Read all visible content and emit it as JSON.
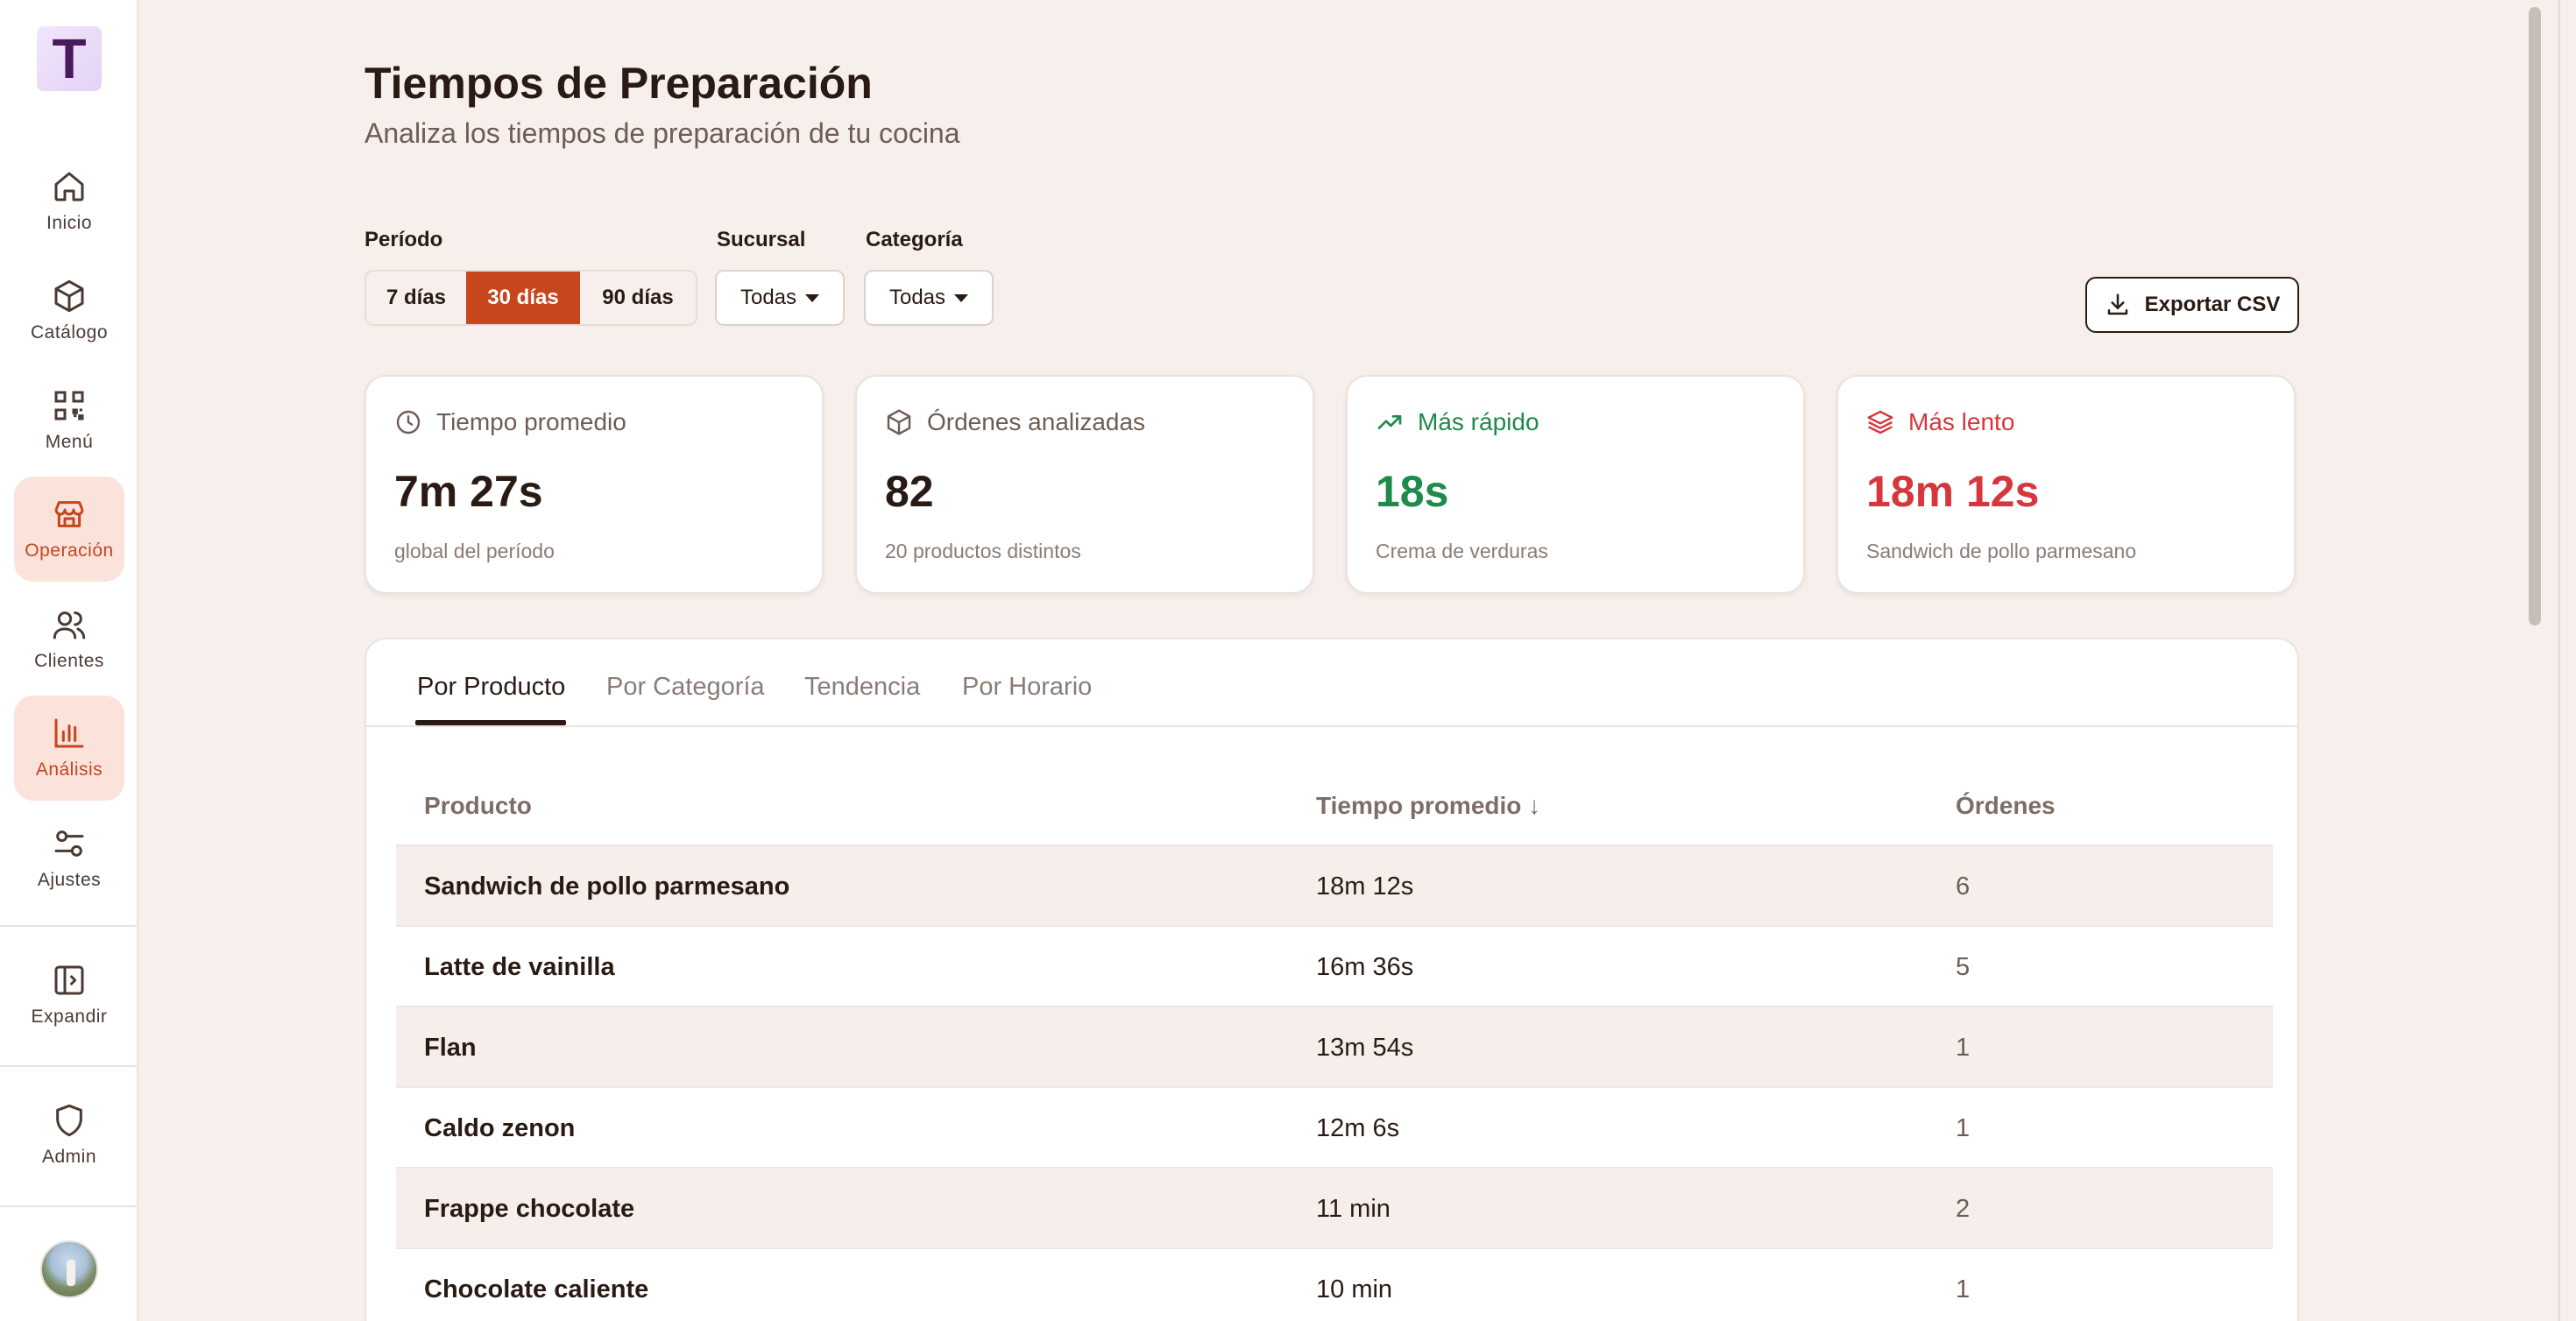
{
  "sidebar": {
    "logo_letter": "T",
    "items": [
      {
        "label": "Inicio",
        "icon": "home-icon"
      },
      {
        "label": "Catálogo",
        "icon": "package-icon"
      },
      {
        "label": "Menú",
        "icon": "qr-code-icon"
      },
      {
        "label": "Operación",
        "icon": "store-icon",
        "active": true
      },
      {
        "label": "Clientes",
        "icon": "users-icon"
      },
      {
        "label": "Análisis",
        "icon": "bar-chart-icon",
        "active": true
      },
      {
        "label": "Ajustes",
        "icon": "sliders-icon"
      }
    ],
    "expand_label": "Expandir",
    "admin_label": "Admin"
  },
  "header": {
    "title": "Tiempos de Preparación",
    "subtitle": "Analiza los tiempos de preparación de tu cocina"
  },
  "filters": {
    "period_label": "Período",
    "period_options": [
      "7 días",
      "30 días",
      "90 días"
    ],
    "period_selected": "30 días",
    "branch_label": "Sucursal",
    "branch_value": "Todas",
    "category_label": "Categoría",
    "category_value": "Todas"
  },
  "export_label": "Exportar CSV",
  "kpis": {
    "avg": {
      "title": "Tiempo promedio",
      "value": "7m 27s",
      "note": "global del período",
      "icon": "clock-icon"
    },
    "orders": {
      "title": "Órdenes analizadas",
      "value": "82",
      "note": "20 productos distintos",
      "icon": "package-icon"
    },
    "fastest": {
      "title": "Más rápido",
      "value": "18s",
      "note": "Crema de verduras",
      "icon": "trending-up-icon",
      "color": "#1f8a4a"
    },
    "slowest": {
      "title": "Más lento",
      "value": "18m 12s",
      "note": "Sandwich de pollo parmesano",
      "icon": "layers-icon",
      "color": "#d6373c"
    }
  },
  "tabs": [
    "Por Producto",
    "Por Categoría",
    "Tendencia",
    "Por Horario"
  ],
  "active_tab": "Por Producto",
  "table": {
    "headers": {
      "product": "Producto",
      "avg_time": "Tiempo promedio ↓",
      "orders": "Órdenes"
    },
    "rows": [
      {
        "product": "Sandwich de pollo parmesano",
        "avg_time": "18m 12s",
        "orders": "6"
      },
      {
        "product": "Latte de vainilla",
        "avg_time": "16m 36s",
        "orders": "5"
      },
      {
        "product": "Flan",
        "avg_time": "13m 54s",
        "orders": "1"
      },
      {
        "product": "Caldo zenon",
        "avg_time": "12m 6s",
        "orders": "1"
      },
      {
        "product": "Frappe chocolate",
        "avg_time": "11 min",
        "orders": "2"
      },
      {
        "product": "Chocolate caliente",
        "avg_time": "10 min",
        "orders": "1"
      }
    ]
  }
}
